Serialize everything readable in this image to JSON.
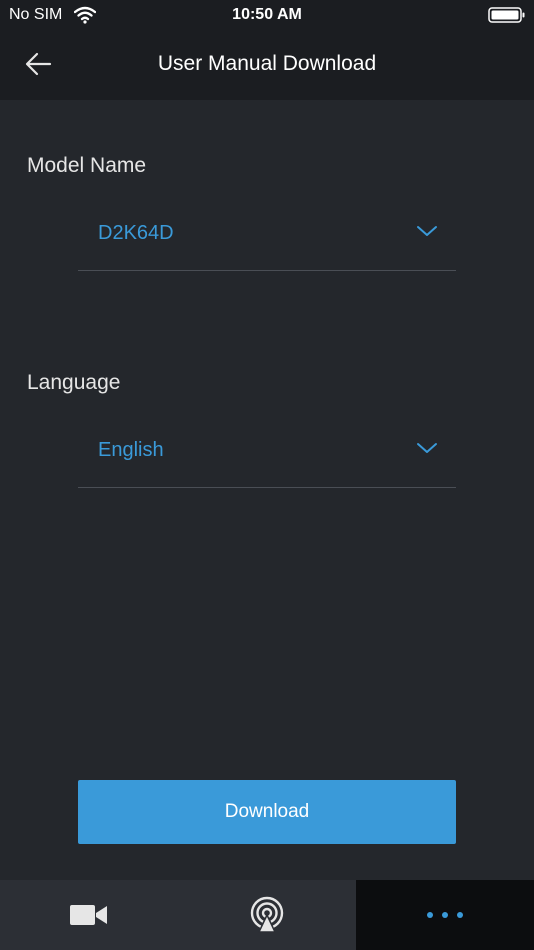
{
  "status_bar": {
    "carrier": "No SIM",
    "time": "10:50 AM",
    "icons": [
      "wifi-icon",
      "battery-icon"
    ]
  },
  "nav": {
    "title": "User Manual Download",
    "back_icon": "arrow-left-icon"
  },
  "form": {
    "model": {
      "label": "Model Name",
      "value": "D2K64D",
      "icon": "chevron-down-icon"
    },
    "language": {
      "label": "Language",
      "value": "English",
      "icon": "chevron-down-icon"
    }
  },
  "actions": {
    "download_label": "Download"
  },
  "tab_bar": {
    "tabs": [
      {
        "icon": "video-camera-icon",
        "active": false
      },
      {
        "icon": "broadcast-icon",
        "active": false
      },
      {
        "icon": "more-dots-icon",
        "active": true
      }
    ]
  },
  "colors": {
    "background": "#24272c",
    "header": "#1b1d21",
    "accent": "#3a9ad9",
    "tab_bar": "#2c2f35",
    "active_tab": "#0c0d0f"
  }
}
